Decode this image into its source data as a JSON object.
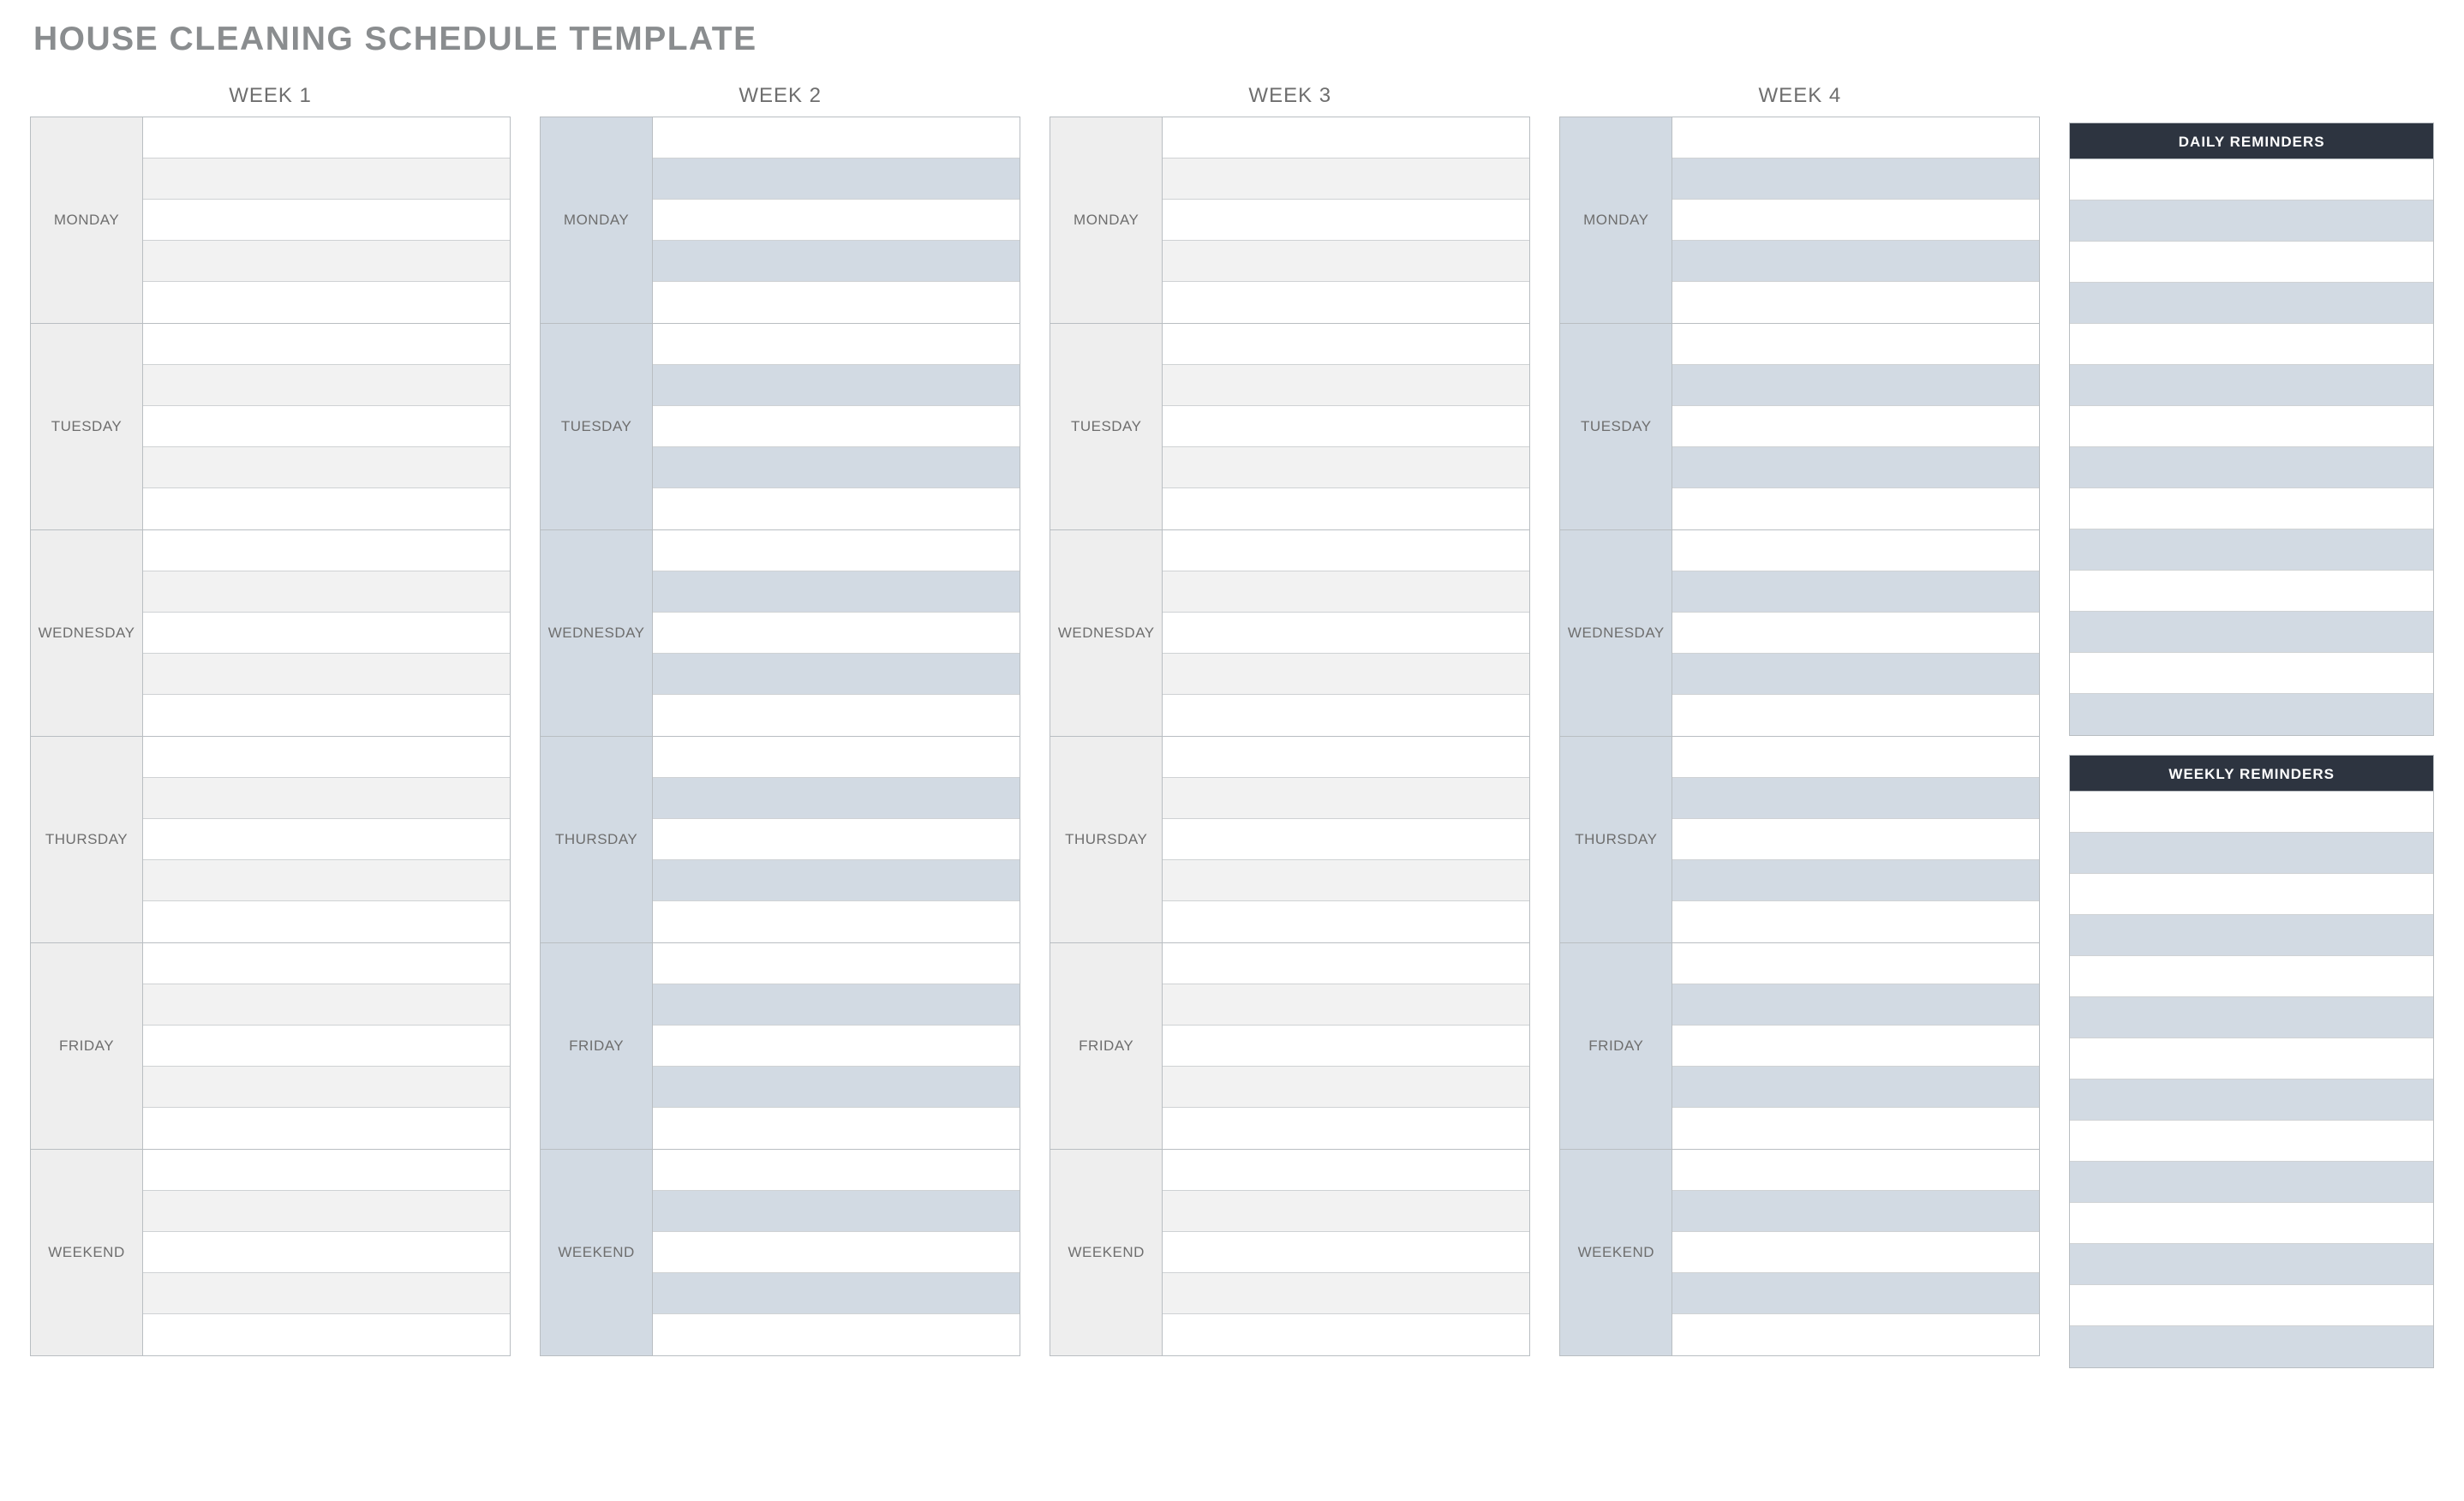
{
  "title": "HOUSE CLEANING SCHEDULE TEMPLATE",
  "weeks": [
    {
      "label": "WEEK 1",
      "tone": "a"
    },
    {
      "label": "WEEK 2",
      "tone": "b"
    },
    {
      "label": "WEEK 3",
      "tone": "a"
    },
    {
      "label": "WEEK 4",
      "tone": "b"
    }
  ],
  "days": [
    "MONDAY",
    "TUESDAY",
    "WEDNESDAY",
    "THURSDAY",
    "FRIDAY",
    "WEEKEND"
  ],
  "slots_per_day": 5,
  "reminders": {
    "daily": {
      "header": "DAILY REMINDERS",
      "rows": 14
    },
    "weekly": {
      "header": "WEEKLY REMINDERS",
      "rows": 14
    }
  }
}
